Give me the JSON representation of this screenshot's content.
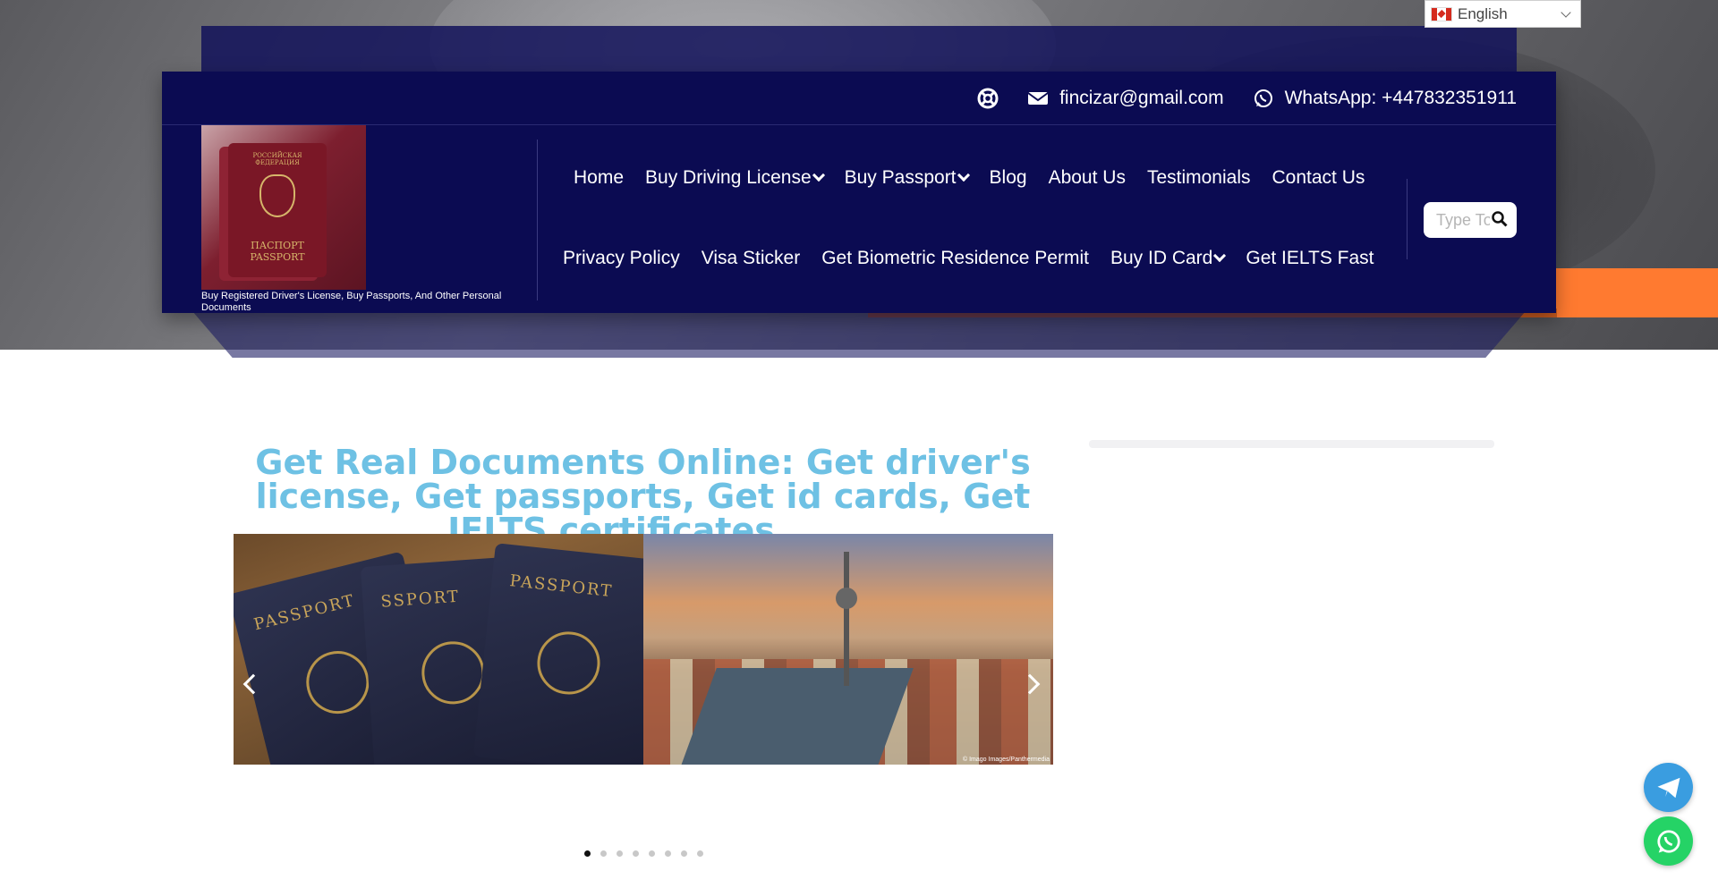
{
  "language": {
    "selected": "English"
  },
  "topbar": {
    "email": "fincizar@gmail.com",
    "whatsapp": "WhatsApp: +447832351911"
  },
  "logo": {
    "tagline": "Buy Registered Driver's License, Buy Passports, And Other Personal Documents",
    "passport_top": "РОССИЙСКАЯ ФЕДЕРАЦИЯ",
    "passport_bottom": "ПАСПОРТ PASSPORT"
  },
  "nav": {
    "row1": [
      {
        "label": "Home",
        "dropdown": false
      },
      {
        "label": "Buy Driving License",
        "dropdown": true
      },
      {
        "label": "Buy Passport",
        "dropdown": true
      },
      {
        "label": "Blog",
        "dropdown": false
      },
      {
        "label": "About Us",
        "dropdown": false
      },
      {
        "label": "Testimonials",
        "dropdown": false
      },
      {
        "label": "Contact Us",
        "dropdown": false
      }
    ],
    "row2": [
      {
        "label": "Privacy Policy",
        "dropdown": false
      },
      {
        "label": "Visa Sticker",
        "dropdown": false
      },
      {
        "label": "Get Biometric Residence Permit",
        "dropdown": false
      },
      {
        "label": "Buy ID Card",
        "dropdown": true
      },
      {
        "label": "Get IELTS Fast",
        "dropdown": false
      }
    ]
  },
  "search": {
    "placeholder": "Type To Search"
  },
  "main": {
    "headline": "Get Real Documents Online: Get driver's license, Get passports, Get id cards, Get IELTS certificates ...."
  },
  "slider": {
    "slide1_label": "PASSPORT",
    "slide1_label2": "SSPORT",
    "slide2_credit": "© Imago Images/Panthermedia",
    "dot_count": 8,
    "active_dot": 0
  },
  "colors": {
    "header_bg": "#0b0b52",
    "headline": "#6ec1e4",
    "accent_orange": "#ff7a30",
    "telegram": "#3a9de0",
    "whatsapp": "#25d366"
  }
}
